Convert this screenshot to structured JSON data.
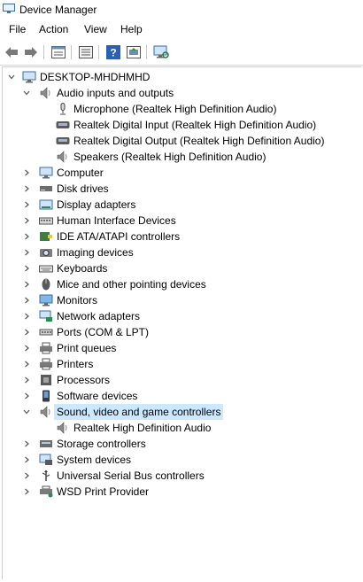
{
  "window": {
    "title": "Device Manager"
  },
  "menu": [
    "File",
    "Action",
    "View",
    "Help"
  ],
  "toolbar": {
    "buttons": [
      "back-icon",
      "forward-icon",
      "properties-icon",
      "show-hidden-icon",
      "help-icon",
      "update-driver-icon",
      "scan-hardware-icon"
    ]
  },
  "tree": {
    "root": "DESKTOP-MHDHMHD",
    "audio": {
      "label": "Audio inputs and outputs",
      "children": [
        "Microphone (Realtek High Definition Audio)",
        "Realtek Digital Input (Realtek High Definition Audio)",
        "Realtek Digital Output (Realtek High Definition Audio)",
        "Speakers (Realtek High Definition Audio)"
      ]
    },
    "categories_a": [
      "Computer",
      "Disk drives",
      "Display adapters",
      "Human Interface Devices",
      "IDE ATA/ATAPI controllers",
      "Imaging devices",
      "Keyboards",
      "Mice and other pointing devices",
      "Monitors",
      "Network adapters",
      "Ports (COM & LPT)",
      "Print queues",
      "Printers",
      "Processors",
      "Software devices"
    ],
    "sound": {
      "label": "Sound, video and game controllers",
      "children": [
        "Realtek High Definition Audio"
      ]
    },
    "categories_b": [
      "Storage controllers",
      "System devices",
      "Universal Serial Bus controllers",
      "WSD Print Provider"
    ]
  },
  "colors": {
    "selection": "#cce8ff",
    "accent": "#0078d7"
  }
}
